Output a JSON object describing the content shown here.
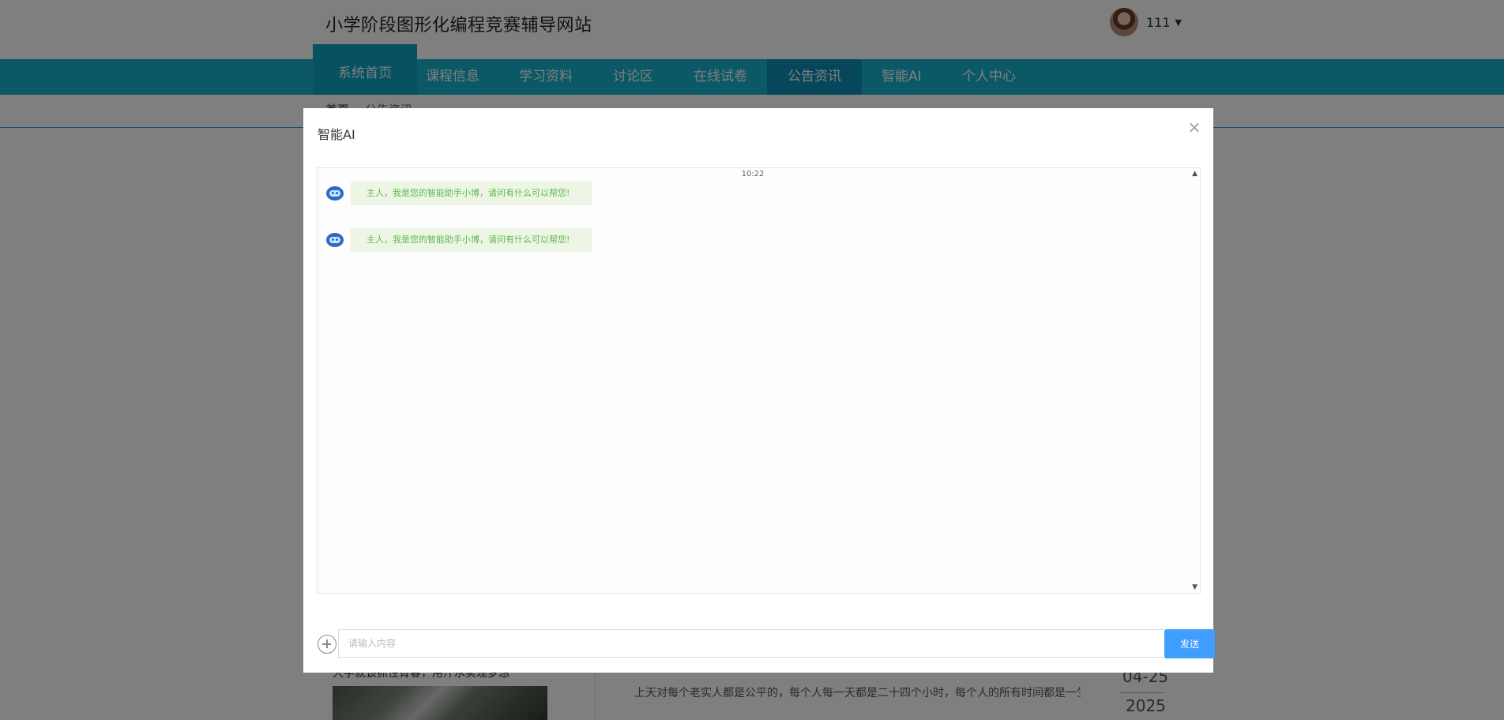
{
  "site": {
    "title": "小学阶段图形化编程竞赛辅导网站"
  },
  "user": {
    "name": "111"
  },
  "nav": {
    "home": "系统首页",
    "items": [
      "课程信息",
      "学习资料",
      "讨论区",
      "在线试卷",
      "公告资讯",
      "智能AI",
      "个人中心"
    ],
    "active": "公告资讯"
  },
  "breadcrumb": [
    "首页",
    "公告资讯"
  ],
  "background_news": {
    "title": "大学就该抓住青春，用汗水实现梦想",
    "text": "上天对每个老实人都是公平的，每个人每一天都是二十四个小时，每个人的所有时间都是一生;同时上天对每个老实人又是不公平的，给每一个人的时间不都是二十四个小时，给...",
    "date_md": "04-25",
    "date_year": "2025"
  },
  "modal": {
    "title": "智能AI",
    "close": "×",
    "time": "10:22",
    "messages": [
      "主人，我是您的智能助手小博，请问有什么可以帮您!",
      "主人，我是您的智能助手小博，请问有什么可以帮您!"
    ],
    "input_placeholder": "请输入内容",
    "send_label": "发送"
  }
}
